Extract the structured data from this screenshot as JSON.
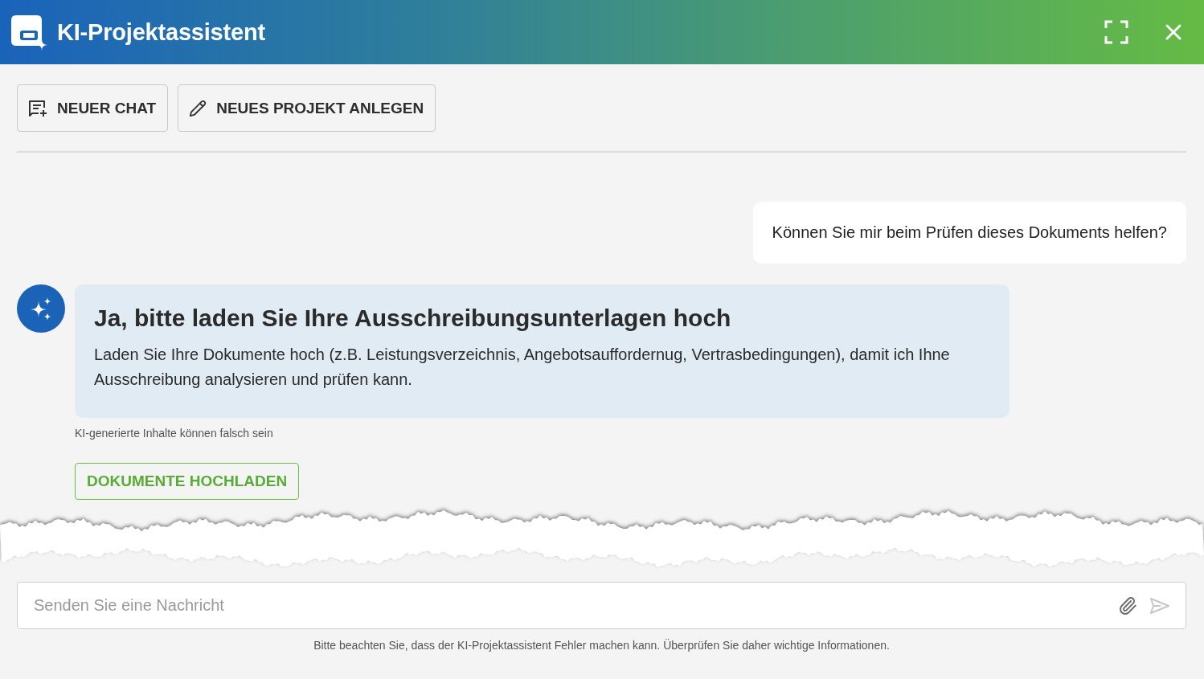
{
  "window": {
    "title": "KI-Projektassistent"
  },
  "toolbar": {
    "buttons": [
      {
        "kind": "new-chat",
        "label": "NEUER CHAT"
      },
      {
        "kind": "edit",
        "label": "NEUES PROJEKT ANLEGEN"
      }
    ]
  },
  "messages": [
    {
      "kind": "question",
      "text": "Können Sie mir beim Prüfen dieses Dokuments helfen?"
    },
    {
      "kind": "answer",
      "heading": "Ja, bitte laden Sie Ihre Ausschreibungsunterlagen hoch",
      "text": "Laden Sie Ihre Dokumente hoch (z.B. Leistungsverzeichnis, Angebotsauffordernug, Vertrasbedingungen), damit ich Ihne Ausschreibung analysieren und prüfen kann.",
      "disclaimer": "KI-generierte Inhalte können falsch sein",
      "action": "DOKUMENTE HOCHLADEN"
    }
  ],
  "composer": {
    "placeholder": "Senden Sie eine Nachricht",
    "send_disabled": true
  },
  "footer_note": "Bitte beachten Sie, dass der KI-Projektassistent Fehler machen kann. Überprüfen Sie daher wichtige Informationen."
}
